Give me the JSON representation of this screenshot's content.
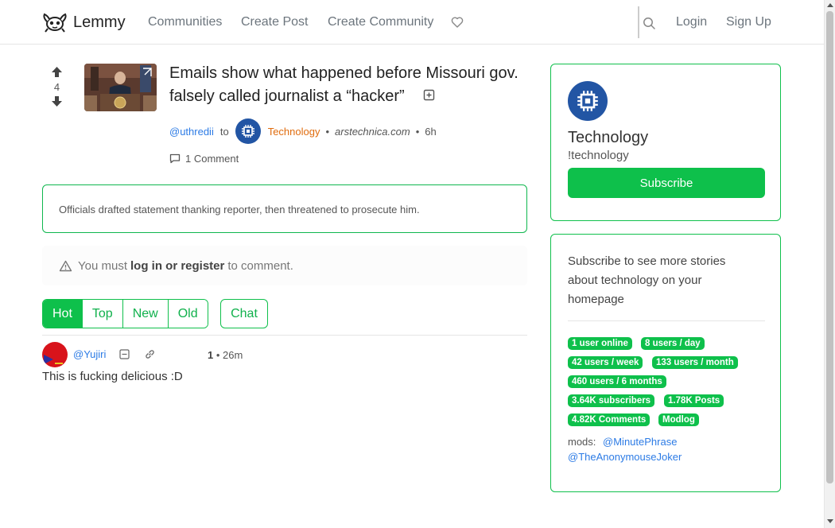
{
  "navbar": {
    "brand": "Lemmy",
    "links": [
      "Communities",
      "Create Post",
      "Create Community"
    ],
    "login": "Login",
    "signup": "Sign Up"
  },
  "post": {
    "score": "4",
    "title": "Emails show what happened before Missouri gov. falsely called journalist a “hacker”",
    "author": "@uthredii",
    "to_label": "to",
    "community": "Technology",
    "domain": "arstechnica.com",
    "age": "6h",
    "comments": "1 Comment",
    "summary": "Officials drafted statement thanking reporter, then threatened to prosecute him."
  },
  "login_alert": {
    "prefix": "You must",
    "link": "log in or register",
    "suffix": "to comment."
  },
  "sort": {
    "options": [
      "Hot",
      "Top",
      "New",
      "Old"
    ],
    "active": "Hot",
    "chat": "Chat"
  },
  "comment": {
    "user": "@Yujiri",
    "score": "1",
    "age": "26m",
    "text": "This is fucking delicious :D"
  },
  "sidebar": {
    "title": "Technology",
    "handle": "!technology",
    "subscribe": "Subscribe",
    "description": "Subscribe to see more stories about technology on your homepage",
    "badges": [
      "1 user online",
      "8 users / day",
      "42 users / week",
      "133 users / month",
      "460 users / 6 months",
      "3.64K subscribers",
      "1.78K Posts",
      "4.82K Comments",
      "Modlog"
    ],
    "mods_label": "mods:",
    "mods": [
      "@MinutePhrase",
      "@TheAnonymouseJoker"
    ]
  },
  "colors": {
    "accent": "#0ec04b",
    "link": "#2c7be5",
    "community": "#e06c0e",
    "icon_bg": "#2255a4"
  }
}
